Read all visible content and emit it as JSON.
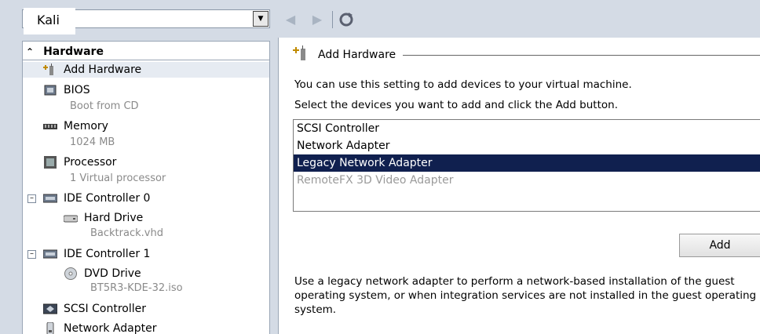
{
  "toolbar": {
    "vm_name": "Kali"
  },
  "tree": {
    "section_title": "Hardware",
    "items": [
      {
        "label": "Add Hardware"
      },
      {
        "label": "BIOS",
        "sub": "Boot from CD"
      },
      {
        "label": "Memory",
        "sub": "1024 MB"
      },
      {
        "label": "Processor",
        "sub": "1 Virtual processor"
      },
      {
        "label": "IDE Controller 0"
      },
      {
        "label": "Hard Drive",
        "sub": "Backtrack.vhd"
      },
      {
        "label": "IDE Controller 1"
      },
      {
        "label": "DVD Drive",
        "sub": "BT5R3-KDE-32.iso"
      },
      {
        "label": "SCSI Controller"
      },
      {
        "label": "Network Adapter"
      }
    ]
  },
  "panel": {
    "title": "Add Hardware",
    "desc1": "You can use this setting to add devices to your virtual machine.",
    "desc2": "Select the devices you want to add and click the Add button.",
    "devices": [
      {
        "label": "SCSI Controller",
        "state": "normal"
      },
      {
        "label": "Network Adapter",
        "state": "normal"
      },
      {
        "label": "Legacy Network Adapter",
        "state": "selected"
      },
      {
        "label": "RemoteFX 3D Video Adapter",
        "state": "disabled"
      }
    ],
    "add_label": "Add",
    "help": "Use a legacy network adapter to perform a network-based installation of the guest operating system, or when integration services are not installed in the guest operating system."
  }
}
